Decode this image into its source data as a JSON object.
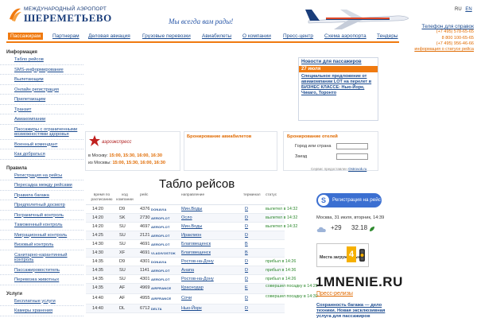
{
  "header": {
    "logo_line1": "МЕЖДУНАРОДНЫЙ АЭРОПОРТ",
    "logo_line2": "ШЕРЕМЕТЬЕВО",
    "slogan": "Мы всегда вам рады!",
    "langs": [
      "RU",
      "EN"
    ],
    "phones_title": "Телефон для справок",
    "phones": [
      "(+7 495) 578-65-65",
      "8 800 100-65-65",
      "(+7 495) 956-46-66"
    ],
    "phones_link": "информация о статусе рейса"
  },
  "nav": {
    "items": [
      "Пассажирам",
      "Партнерам",
      "Деловая авиация",
      "Грузовые перевозки",
      "Авиабилеты",
      "О компании",
      "Пресс-центр",
      "Схема аэропорта",
      "Тендеры"
    ],
    "active_index": 0,
    "accent": "#f07a10"
  },
  "sidebar": {
    "info_title": "Информация",
    "info_items": [
      "Табло рейсов",
      "SMS-информирование",
      "Вылетающим",
      "Онлайн регистрация",
      "Прилетающим",
      "Транзит",
      "Авиакомпании",
      "Пассажиры с ограниченными возможностями здоровья",
      "Военный комендант",
      "Как добраться"
    ],
    "rules_title": "Правила",
    "rules_items": [
      "Регистрация на рейсы",
      "Пересадка между рейсами",
      "Правила багажа",
      "Предполетный досмотр",
      "Пограничный контроль",
      "Таможенный контроль",
      "Миграционный контроль",
      "Визовый контроль",
      "Санитарно-карантинный контроль",
      "Пассажировоститель",
      "Перевозка животных"
    ],
    "services_title": "Услуги",
    "services_items": [
      "Бесплатные услуги",
      "Камеры хранения"
    ]
  },
  "news": {
    "title": "Новости для пассажиров",
    "date": "27 июля",
    "text": "Специальное предложение от авиакомпании LOT на перелет в БИЗНЕС КЛАССЕ: Нью-Йорк, Чикаго, Торонто"
  },
  "aeroexpress": {
    "name": "аэроэкспресс",
    "row1_label": "в Москву:",
    "row1_times": "15:00, 15:30, 16:00, 16:30",
    "row2_label": "из Москвы:",
    "row2_times": "15:00, 15:30, 16:00, 16:30"
  },
  "tickets": {
    "title": "Бронирование авиабилетов"
  },
  "hotels": {
    "title": "Бронирование отелей",
    "city_label": "Город или страна",
    "arrival_label": "Заезд",
    "source_prefix": "Сервис предоставлен",
    "source_link": "Ostrovok.ru"
  },
  "board": {
    "title": "Табло рейсов",
    "headers": {
      "time": "время по расписанию",
      "code": "код компании",
      "flight": "рейс",
      "dest": "направление",
      "term": "терминал",
      "status": "статус"
    },
    "rows": [
      {
        "time": "14:20",
        "code": "D9",
        "flight": "4376",
        "dest": "Мин.Воды",
        "term": "D",
        "status": "вылетел в 14:32",
        "airline": "DONAVIA"
      },
      {
        "time": "14:20",
        "code": "SK",
        "flight": "2730",
        "dest": "Осло",
        "term": "D",
        "status": "вылетел в 14:32",
        "airline": "AEROFLOT"
      },
      {
        "time": "14:20",
        "code": "SU",
        "flight": "4697",
        "dest": "Мин.Воды",
        "term": "D",
        "status": "вылетел в 14:32",
        "airline": "AEROFLOT"
      },
      {
        "time": "14:25",
        "code": "SU",
        "flight": "2121",
        "dest": "Ираклион",
        "term": "D",
        "status": "",
        "airline": "AEROFLOT"
      },
      {
        "time": "14:30",
        "code": "SU",
        "flight": "4691",
        "dest": "Благовещенск",
        "term": "B",
        "status": "",
        "airline": "AEROFLOT"
      },
      {
        "time": "14:30",
        "code": "XF",
        "flight": "4691",
        "dest": "Благовещенск",
        "term": "B",
        "status": "",
        "airline": "VLADIVOSTOK"
      },
      {
        "time": "14:35",
        "code": "D9",
        "flight": "4301",
        "dest": "Ростов-на-Дону",
        "term": "D",
        "status": "прибыл в 14:26",
        "airline": "DONAVIA"
      },
      {
        "time": "14:35",
        "code": "SU",
        "flight": "1141",
        "dest": "Анапа",
        "term": "D",
        "status": "прибыл в 14:36",
        "airline": "AEROFLOT"
      },
      {
        "time": "14:35",
        "code": "SU",
        "flight": "4301",
        "dest": "Ростов-на-Дону",
        "term": "D",
        "status": "прибыл в 14:26",
        "airline": "AEROFLOT"
      },
      {
        "time": "14:35",
        "code": "AF",
        "flight": "4969",
        "dest": "Краснодар",
        "term": "E",
        "status": "совершил посадку в 14:29",
        "airline": "AIRFRANCE"
      },
      {
        "time": "14:40",
        "code": "AF",
        "flight": "4955",
        "dest": "Сочи",
        "term": "D",
        "status": "совершил посадку в 14:30",
        "airline": "AIRFRANCE"
      },
      {
        "time": "14:40",
        "code": "DL",
        "flight": "6712",
        "dest": "Нью-Йорк",
        "term": "D",
        "status": "",
        "airline": "DELTA"
      }
    ]
  },
  "checkin": {
    "label": "Регистрация на рейс"
  },
  "widget": {
    "datetime": "Москва, 31 июля, вторник, 14:39",
    "temp": "+29",
    "time": "32.18",
    "parking_title": "Места загруженные",
    "parking_level": "4"
  },
  "watermark": "1MNENIE.RU",
  "press": {
    "title": "Пресс-релизы",
    "item": "Сохранность багажа — дело техники. Новая эксклюзивная услуга для пассажиров Шереметьево"
  }
}
